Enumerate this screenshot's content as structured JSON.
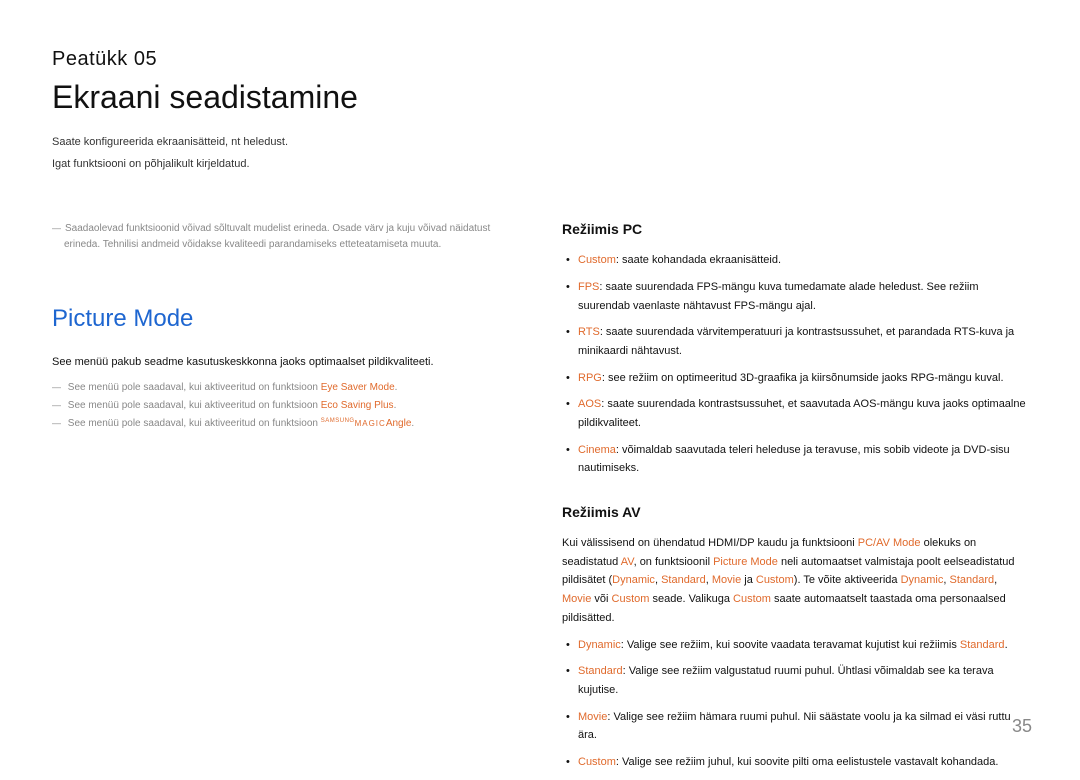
{
  "chapter": {
    "label": "Peatükk 05",
    "title": "Ekraani seadistamine",
    "intro1": "Saate konfigureerida ekraanisätteid, nt heledust.",
    "intro2": "Igat funktsiooni on põhjalikult kirjeldatud."
  },
  "left": {
    "top_note1": "Saadaolevad funktsioonid võivad sõltuvalt mudelist erineda. Osade värv ja kuju võivad näidatust erineda. Tehnilisi andmeid võidakse kvaliteedi parandamiseks etteteatamiseta muuta.",
    "section_heading": "Picture Mode",
    "body1": "See menüü pakub seadme kasutuskeskkonna jaoks optimaalset pildikvaliteeti.",
    "note_pre": "See menüü pole saadaval, kui aktiveeritud on funktsioon ",
    "note1_hl": "Eye Saver Mode",
    "note2_hl": "Eco Saving Plus",
    "note3_hl": "Angle",
    "magic_sup": "SAMSUNG",
    "magic_main": "MAGIC"
  },
  "right": {
    "pc_heading": "Režiimis PC",
    "pc_items": [
      {
        "hl": "Custom",
        "rest": ": saate kohandada ekraanisätteid."
      },
      {
        "hl": "FPS",
        "rest": ": saate suurendada FPS-mängu kuva tumedamate alade heledust. See režiim suurendab vaenlaste nähtavust FPS-mängu ajal."
      },
      {
        "hl": "RTS",
        "rest": ": saate suurendada värvitemperatuuri ja kontrastsussuhet, et parandada RTS-kuva ja minikaardi nähtavust."
      },
      {
        "hl": "RPG",
        "rest": ": see režiim on optimeeritud 3D-graafika ja kiirsõnumside jaoks RPG-mängu kuval."
      },
      {
        "hl": "AOS",
        "rest": ": saate suurendada kontrastsussuhet, et saavutada AOS-mängu kuva jaoks optimaalne pildikvaliteet."
      },
      {
        "hl": "Cinema",
        "rest": ": võimaldab saavutada teleri heleduse ja teravuse, mis sobib videote ja DVD-sisu nautimiseks."
      }
    ],
    "av_heading": "Režiimis AV",
    "av_para_parts": {
      "p1": "Kui välissisend on ühendatud HDMI/DP kaudu ja funktsiooni ",
      "hl1": "PC/AV Mode",
      "p2": " olekuks on seadistatud ",
      "hl2": "AV",
      "p3": ", on funktsioonil ",
      "hl3": "Picture Mode",
      "p4": " neli automaatset valmistaja poolt eelseadistatud pildisätet (",
      "hl4": "Dynamic",
      "p5": ", ",
      "hl5": "Standard",
      "p6": ", ",
      "hl6": "Movie",
      "p7": " ja ",
      "hl7": "Custom",
      "p8": "). Te võite aktiveerida ",
      "hl8": "Dynamic",
      "p9": ", ",
      "hl9": "Standard",
      "p10": ", ",
      "hl10": "Movie",
      "p11": " või ",
      "hl11": "Custom",
      "p12": " seade. Valikuga ",
      "hl12": "Custom",
      "p13": " saate automaatselt taastada oma personaalsed pildisätted."
    },
    "av_items": [
      {
        "hl": "Dynamic",
        "mid": ": Valige see režiim, kui soovite vaadata teravamat kujutist kui režiimis ",
        "hl2": "Standard",
        "end": "."
      },
      {
        "hl": "Standard",
        "rest": ": Valige see režiim valgustatud ruumi puhul. Ühtlasi võimaldab see ka terava kujutise."
      },
      {
        "hl": "Movie",
        "rest": ": Valige see režiim hämara ruumi puhul. Nii säästate voolu ja ka silmad ei väsi ruttu ära."
      },
      {
        "hl": "Custom",
        "rest": ": Valige see režiim juhul, kui soovite pilti oma eelistustele vastavalt kohandada."
      }
    ]
  },
  "page_number": "35"
}
